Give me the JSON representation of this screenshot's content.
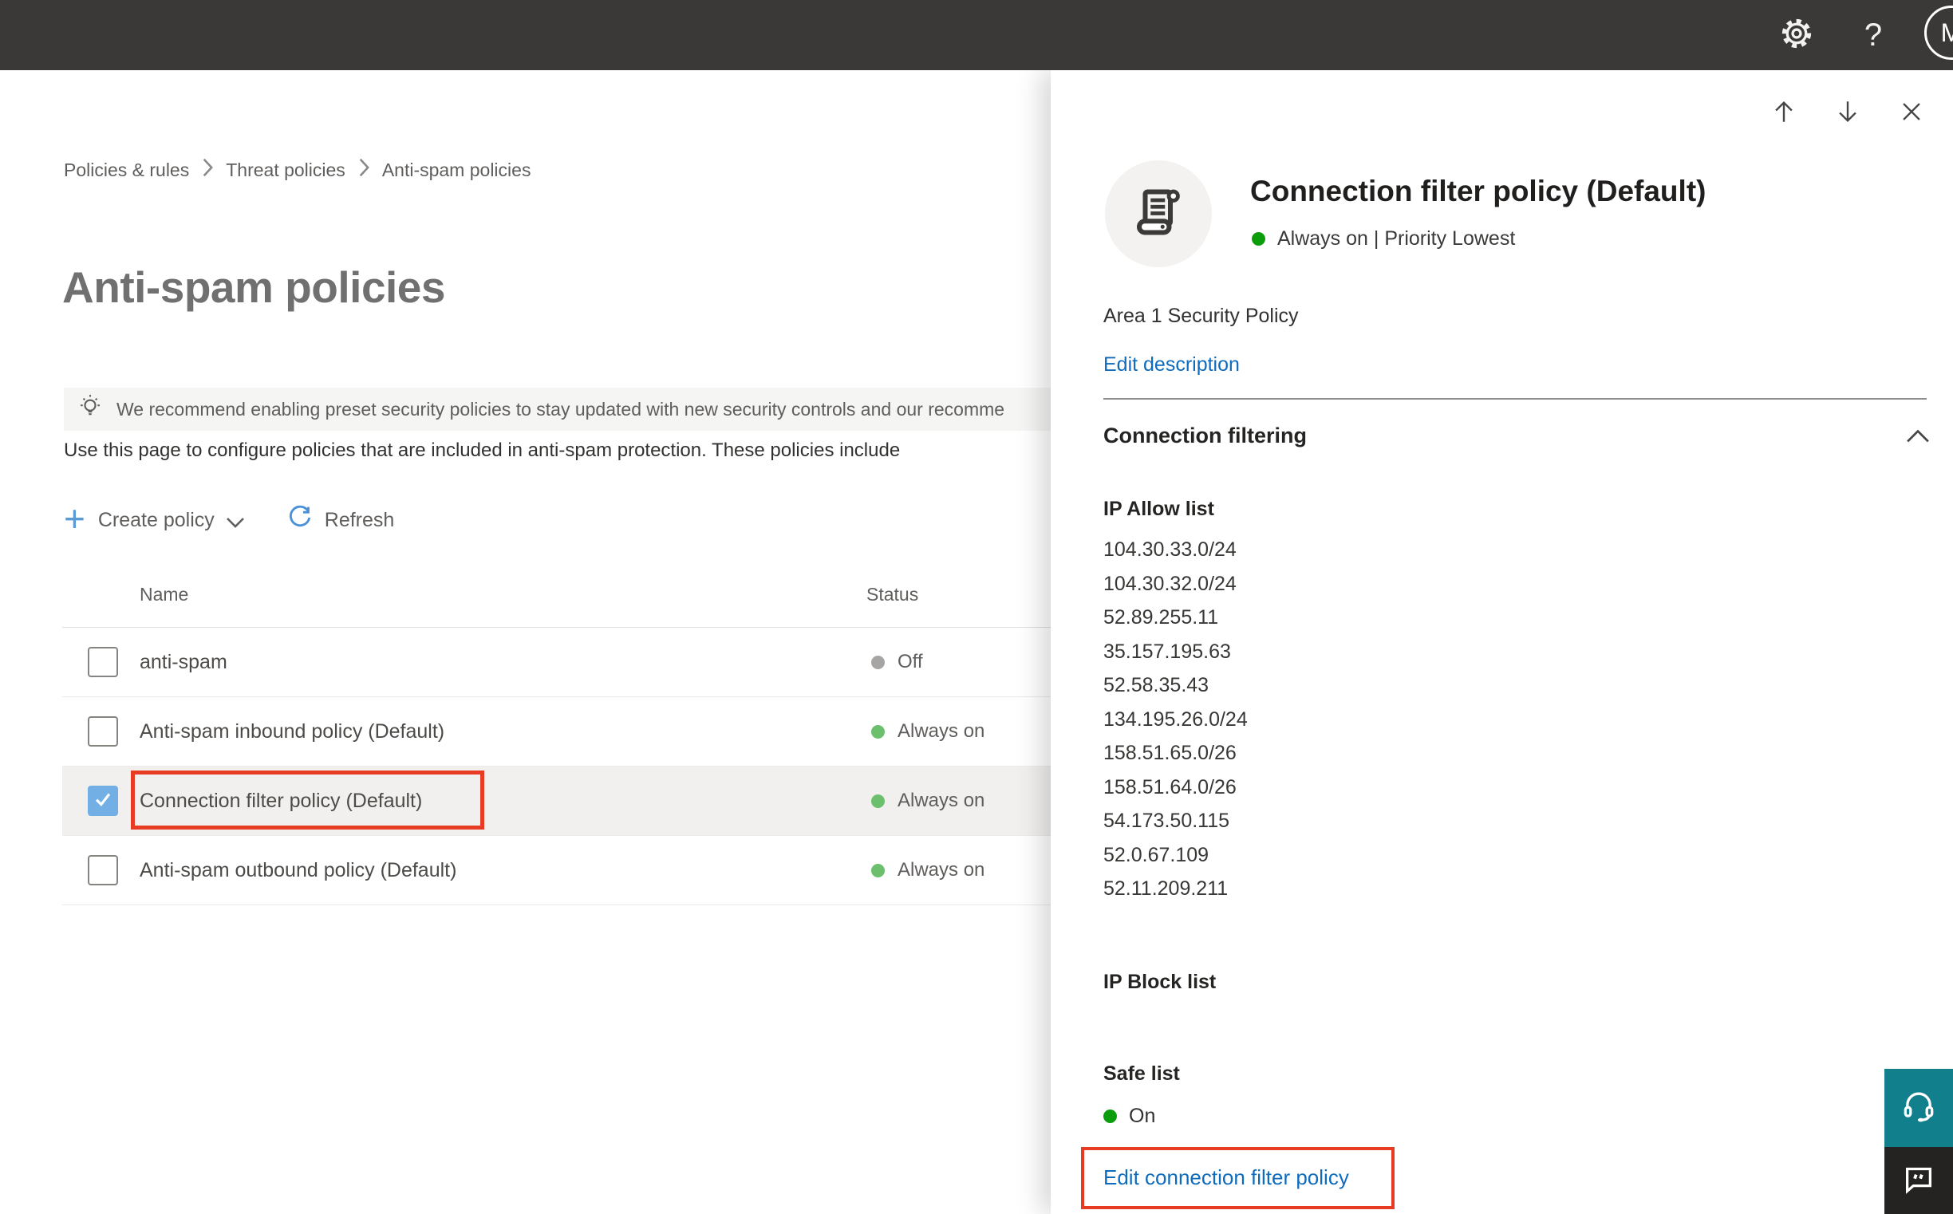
{
  "topbar": {
    "help_label": "?",
    "avatar_initial": "M"
  },
  "breadcrumb": {
    "items": [
      "Policies & rules",
      "Threat policies",
      "Anti-spam policies"
    ]
  },
  "main": {
    "title": "Anti-spam policies",
    "banner_text": "We recommend enabling preset security policies to stay updated with new security controls and our recomme",
    "intro_text": "Use this page to configure policies that are included in anti-spam protection. These policies include",
    "toolbar": {
      "create_label": "Create policy",
      "refresh_label": "Refresh"
    },
    "table": {
      "columns": [
        "Name",
        "Status"
      ],
      "rows": [
        {
          "name": "anti-spam",
          "status": "Off"
        },
        {
          "name": "Anti-spam inbound policy (Default)",
          "status": "Always on"
        },
        {
          "name": "Connection filter policy (Default)",
          "status": "Always on"
        },
        {
          "name": "Anti-spam outbound policy (Default)",
          "status": "Always on"
        }
      ]
    }
  },
  "panel": {
    "title": "Connection filter policy (Default)",
    "status_line": "Always on | Priority Lowest",
    "description": "Area 1 Security Policy",
    "edit_description_label": "Edit description",
    "section_title": "Connection filtering",
    "ip_allow_title": "IP Allow list",
    "ip_allow_items": [
      "104.30.33.0/24",
      "104.30.32.0/24",
      "52.89.255.11",
      "35.157.195.63",
      "52.58.35.43",
      "134.195.26.0/24",
      "158.51.65.0/26",
      "158.51.64.0/26",
      "54.173.50.115",
      "52.0.67.109",
      "52.11.209.211"
    ],
    "ip_block_title": "IP Block list",
    "safe_list_title": "Safe list",
    "safe_list_status": "On",
    "edit_link_label": "Edit connection filter policy"
  },
  "colors": {
    "link_blue": "#0f6cbd",
    "annotation_red": "#e73c23",
    "status_green_bright": "#0c9d0c",
    "status_green_soft": "#6cbf6c",
    "status_gray": "#a7a5a3",
    "checkbox_checked_blue": "#71afe5",
    "topbar_dark": "#3a3938",
    "support_teal": "#12808c",
    "feedback_dark": "#242322"
  }
}
